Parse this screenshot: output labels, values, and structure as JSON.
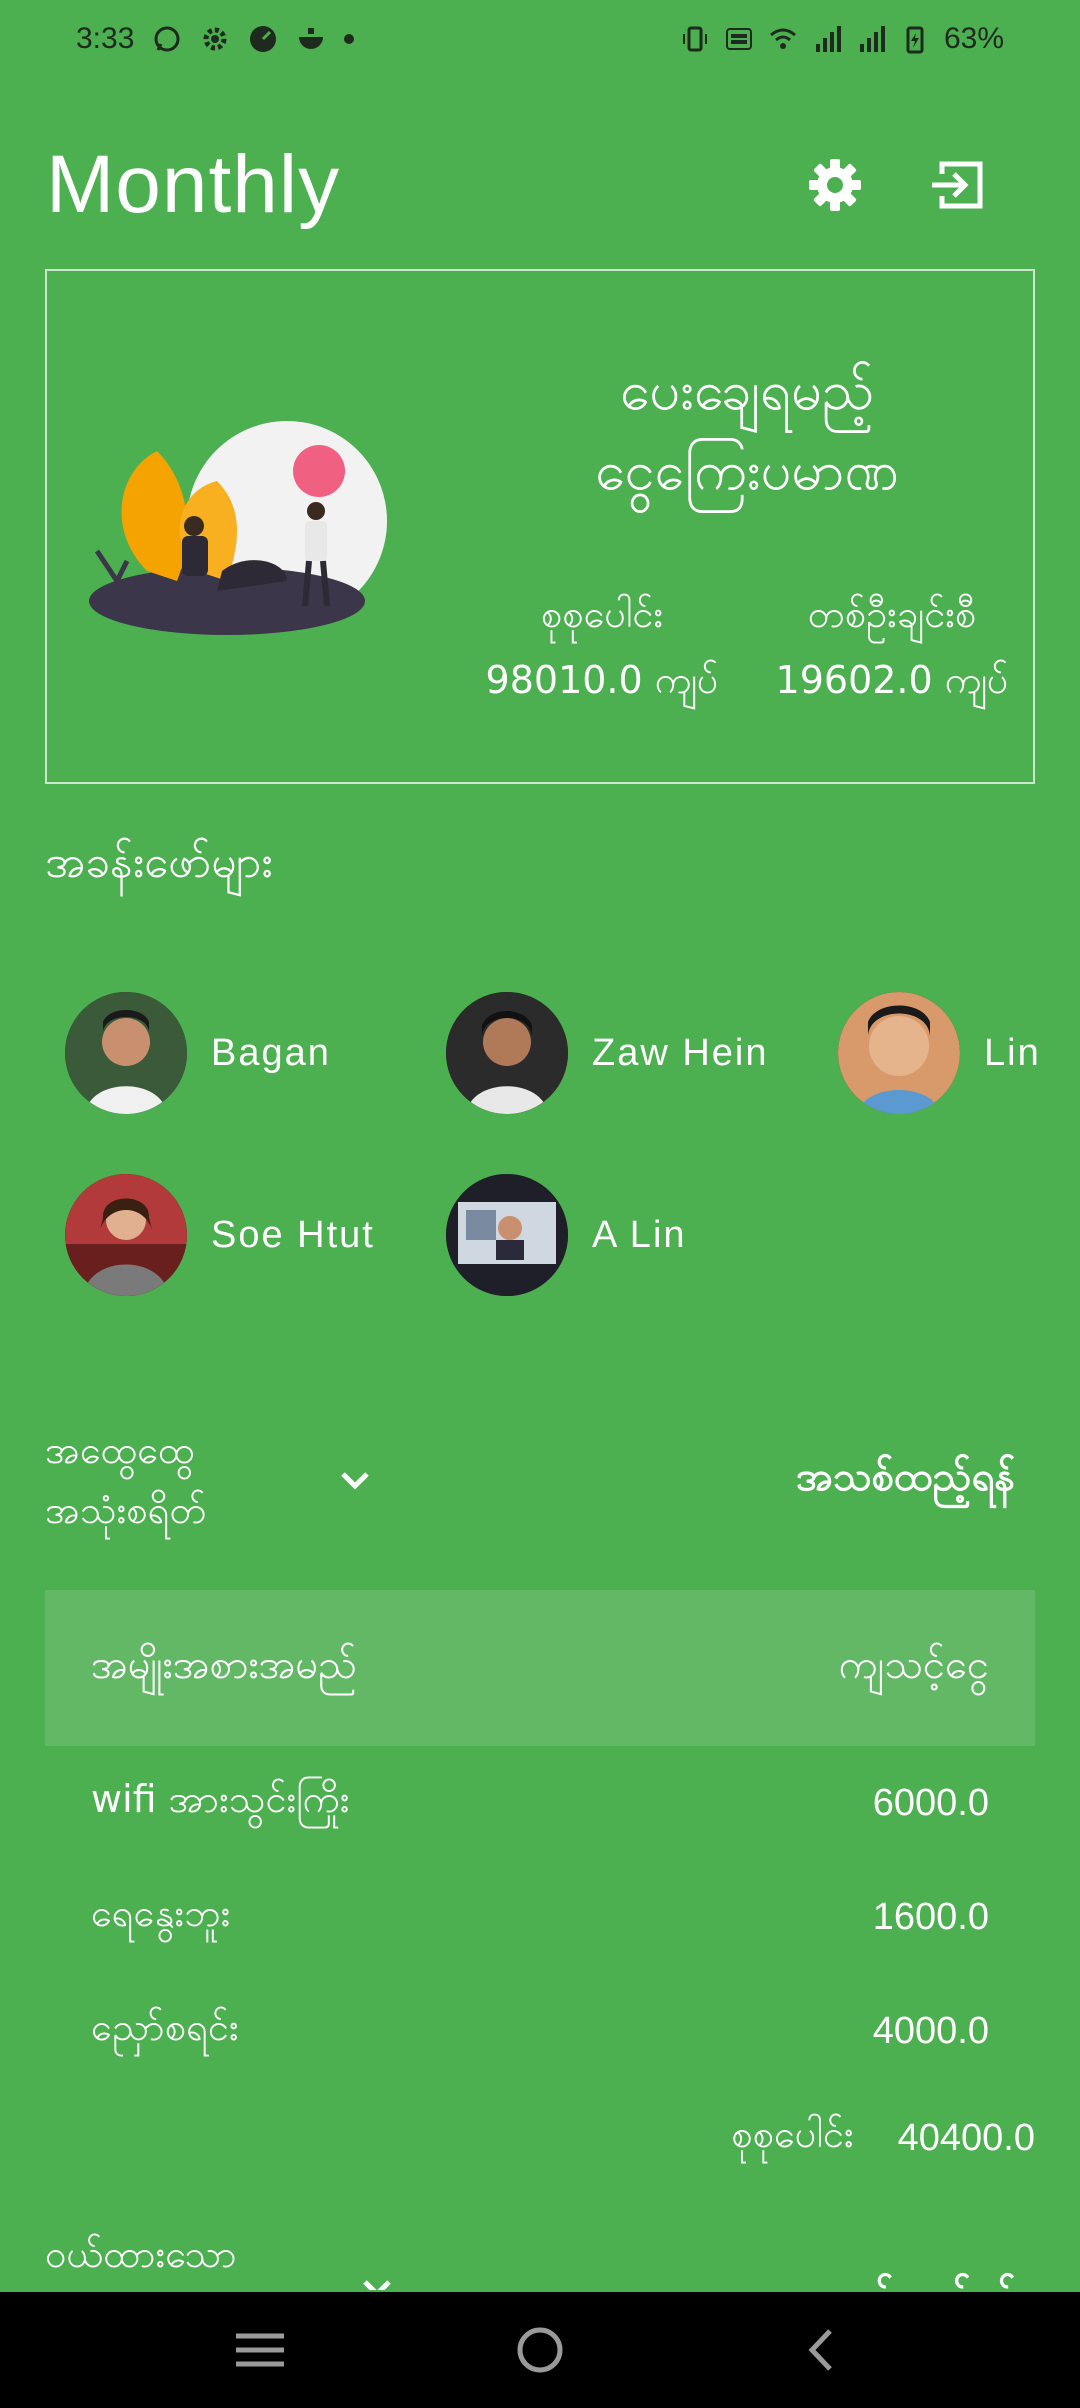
{
  "status_bar": {
    "time": "3:33",
    "battery": "63%"
  },
  "header": {
    "title": "Monthly",
    "settings_icon": "gear-icon",
    "logout_icon": "exit-icon"
  },
  "summary": {
    "title_line1": "ပေးချေရမည့်",
    "title_line2": "ငွေကြေးပမာဏ",
    "total_label": "စုစုပေါင်း",
    "total_value": "98010.0 ကျပ်",
    "each_label": "တစ်ဦးချင်းစီ",
    "each_value": "19602.0 ကျပ်"
  },
  "members_heading": "အခန်းဖော်များ",
  "members": [
    {
      "name": "Bagan",
      "color": "#3a5a3a"
    },
    {
      "name": "Zaw Hein",
      "color": "#2b2b2b"
    },
    {
      "name": "Lin",
      "color": "#d89a6a"
    },
    {
      "name": "Soe Htut",
      "color": "#b23a3a"
    },
    {
      "name": "A Lin",
      "color": "#1f1f2a"
    }
  ],
  "expenses": {
    "title_line1": "အထွေထွေ",
    "title_line2": "အသုံးစရိတ်",
    "add_label": "အသစ်ထည့်ရန်",
    "col_item": "အမျိုးအစားအမည်",
    "col_amount": "ကျသင့်ငွေ",
    "rows": [
      {
        "item": "wifi အားသွင်းကြိုး",
        "amount": "6000.0"
      },
      {
        "item": "ရေနွေးဘူး",
        "amount": "1600.0"
      },
      {
        "item": "ညှော်စရင်း",
        "amount": "4000.0"
      }
    ],
    "total_label": "စုစုပေါင်း",
    "total_value": "40400.0"
  },
  "next_section": {
    "label": "ဝယ်ထားသော",
    "add_label": "အသစ်ထည့်ရန်"
  },
  "colors": {
    "background": "#4CAF50",
    "table_header": "#63B866",
    "nav_bar": "#000000"
  }
}
